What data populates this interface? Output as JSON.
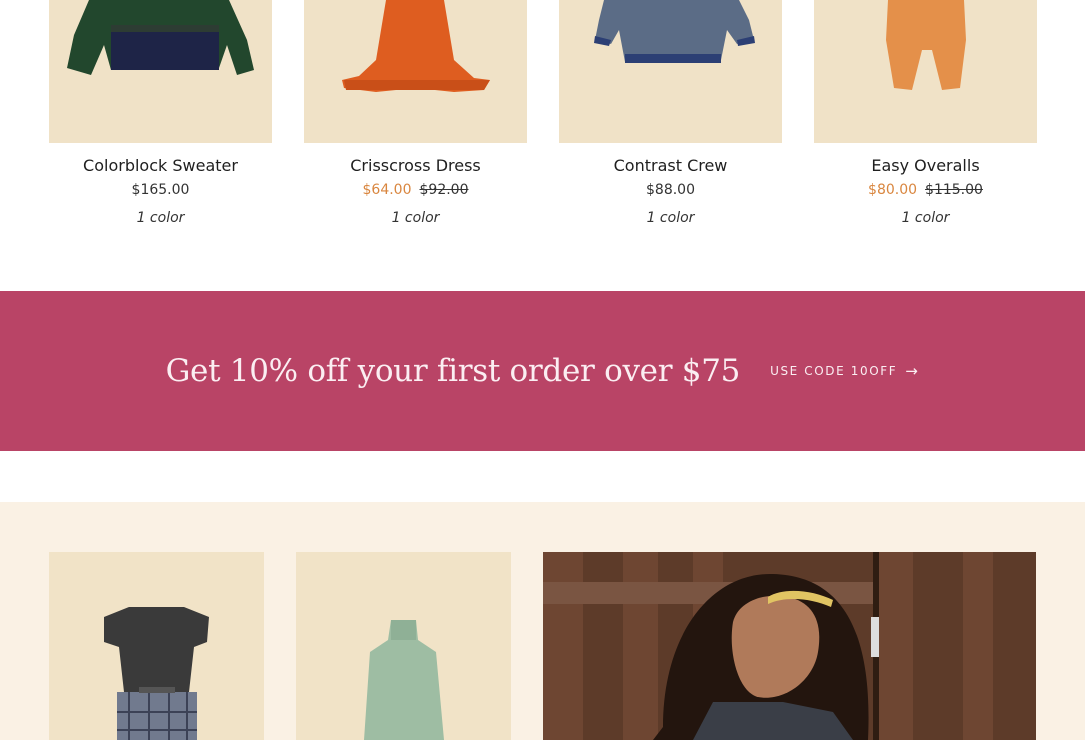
{
  "products": [
    {
      "name": "Colorblock Sweater",
      "price": "$165.00",
      "sale_price": "",
      "original_price": "",
      "colors": "1 color"
    },
    {
      "name": "Crisscross Dress",
      "price": "",
      "sale_price": "$64.00",
      "original_price": "$92.00",
      "colors": "1 color"
    },
    {
      "name": "Contrast Crew",
      "price": "$88.00",
      "sale_price": "",
      "original_price": "",
      "colors": "1 color"
    },
    {
      "name": "Easy Overalls",
      "price": "",
      "sale_price": "$80.00",
      "original_price": "$115.00",
      "colors": "1 color"
    }
  ],
  "promo": {
    "headline": "Get 10% off your first order over $75",
    "cta_label": "USE CODE 10OFF",
    "cta_icon": "arrow-right-icon"
  },
  "colors": {
    "banner": "#b94466",
    "sale": "#d9863f",
    "thumb_bg": "#f0e2c7",
    "section_bg": "#faf1e4"
  }
}
